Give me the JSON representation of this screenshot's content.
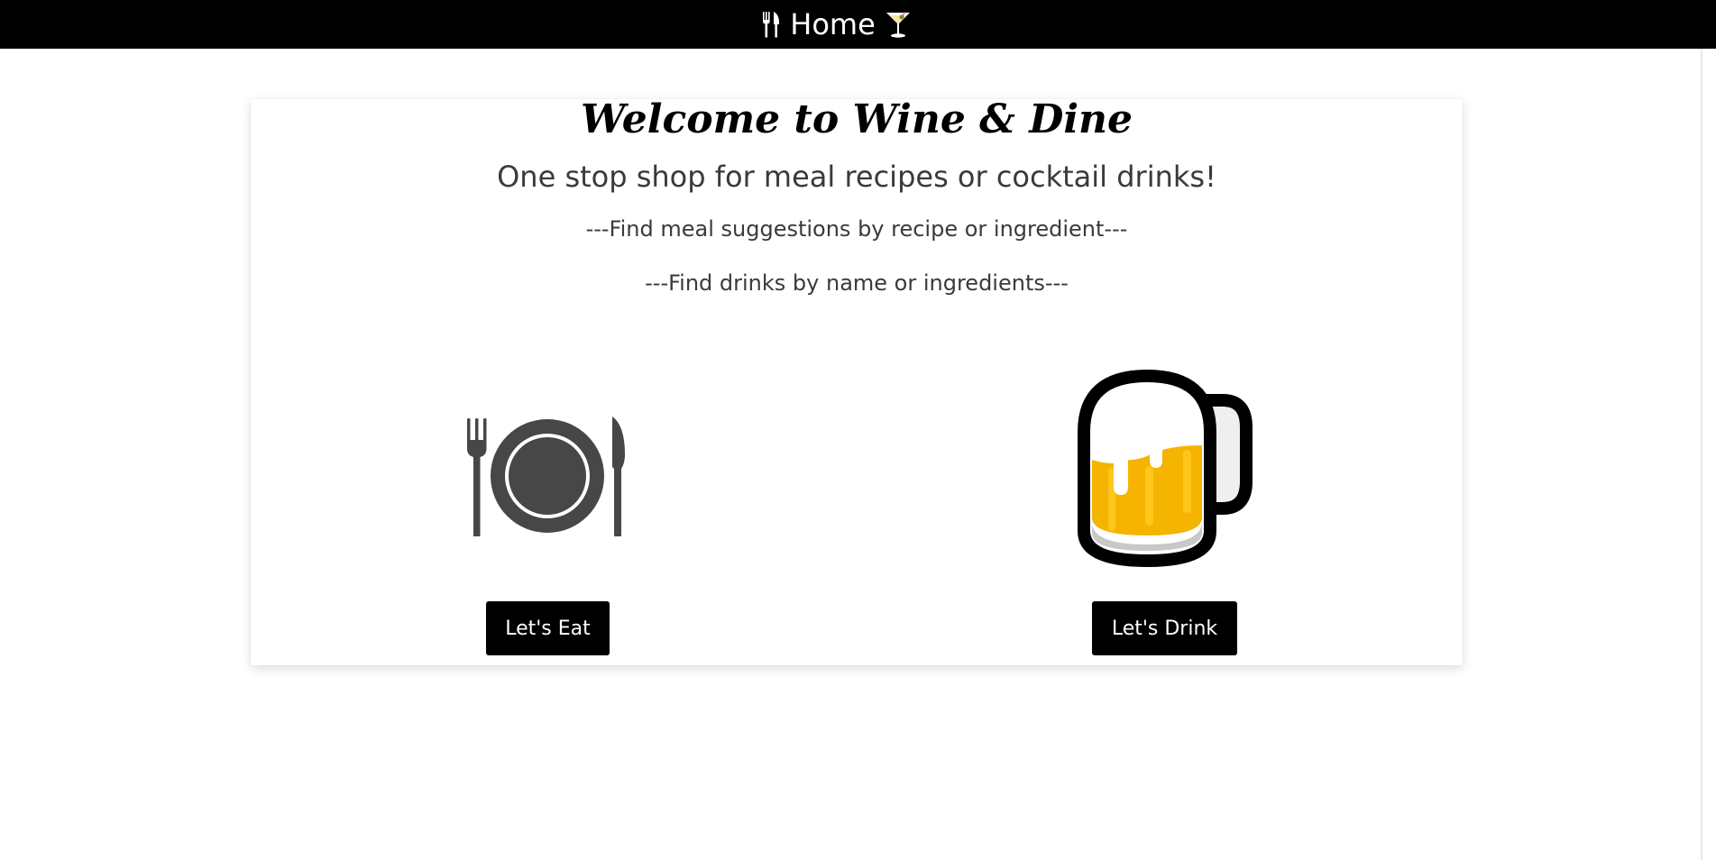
{
  "navbar": {
    "left_icon": "fork-knife-icon",
    "title": "Home",
    "right_icon": "cocktail-glass-icon"
  },
  "hero": {
    "title": "Welcome to Wine & Dine",
    "subtitle": "One stop shop for meal recipes or cocktail drinks!",
    "meal_line": "---Find meal suggestions by recipe or ingredient---",
    "drink_line": "---Find drinks by name or ingredients---"
  },
  "eat": {
    "icon": "plate-cutlery-icon",
    "button_label": "Let's Eat"
  },
  "drink": {
    "icon": "beer-mug-icon",
    "button_label": "Let's Drink"
  },
  "colors": {
    "navbar_bg": "#000000",
    "button_bg": "#000000",
    "text_gray": "#3a3a3a",
    "beer_amber": "#f4b400"
  }
}
